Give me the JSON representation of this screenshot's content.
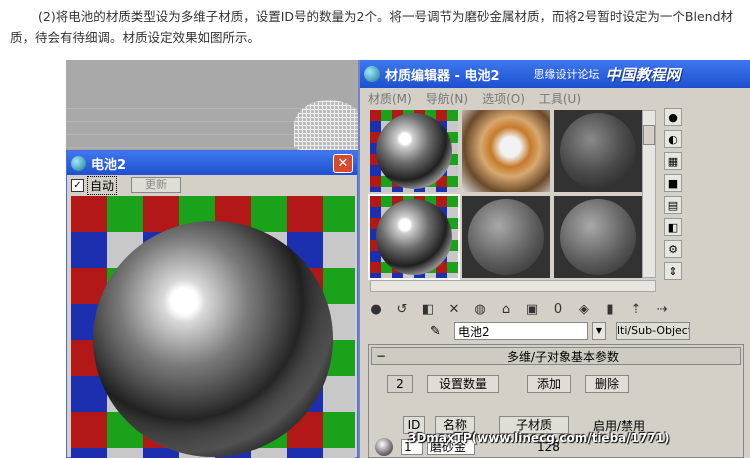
{
  "article": {
    "line1": "(2)将电池的材质类型设为多维子材质，设置ID号的数量为2个。将一号调节为磨砂金属材质，而将2号暂时设定为一个Blend材",
    "line2": "质，待会有待细调。材质设定效果如图所示。"
  },
  "render_window": {
    "title": "电池2",
    "close_glyph": "✕",
    "auto_label": "自动",
    "update_label": "更新"
  },
  "material_editor": {
    "title": "材质编辑器 - 电池2",
    "forum_text": "思缘设计论坛",
    "brand_text": "中国教程网",
    "menu": [
      "材质(M)",
      "导航(N)",
      "选项(O)",
      "工具(U)"
    ],
    "material_name": "电池2",
    "type_button": "lti/Sub-Object",
    "rollout": {
      "title": "多维/子对象基本参数",
      "count": "2",
      "set_count": "设置数量",
      "add": "添加",
      "delete": "删除",
      "col_id": "ID",
      "col_name": "名称",
      "col_submat": "子材质",
      "col_enable": "启用/禁用",
      "row1_id": "1",
      "row1_name": "磨砂金",
      "row1_num": "128"
    }
  },
  "watermark": "3DmaxTP(www.linecg.com/tieba/1771)",
  "icons": [
    "render-window-icon",
    "close-icon",
    "sphere-icon",
    "checker-icon",
    "pick-material-icon",
    "dropdown-icon"
  ]
}
